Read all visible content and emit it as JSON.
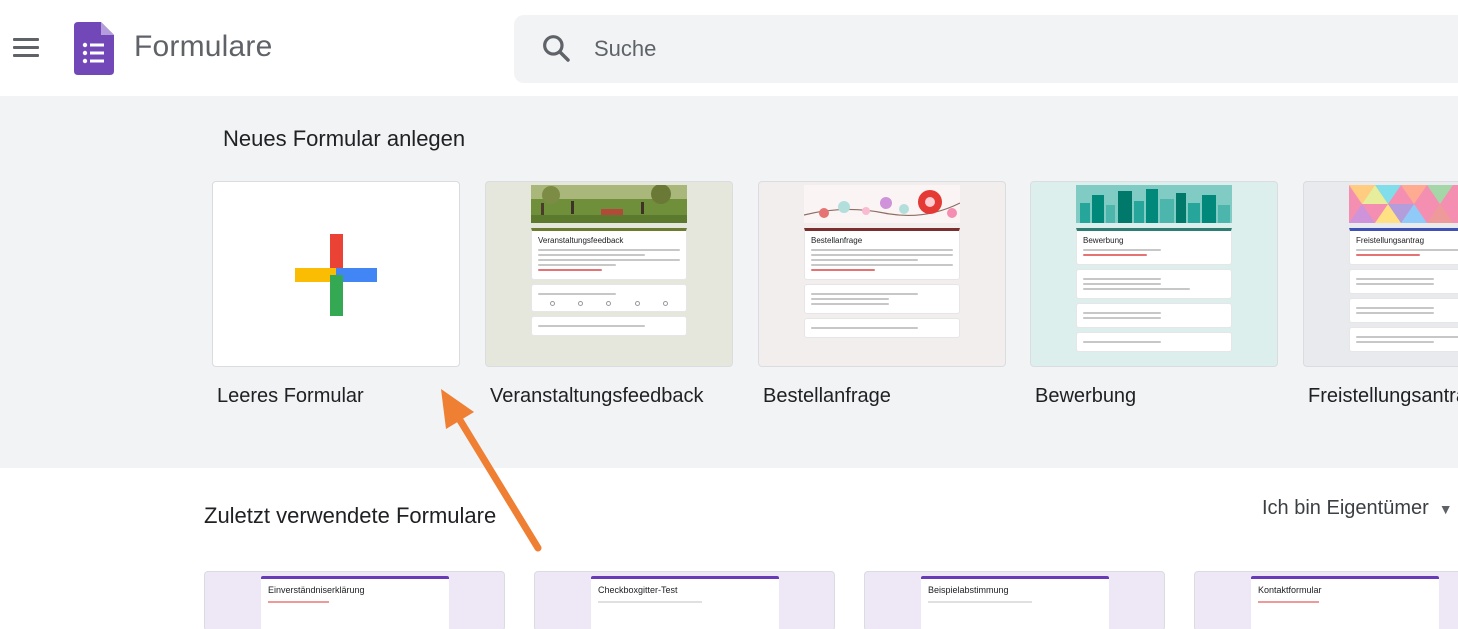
{
  "app": {
    "title": "Formulare"
  },
  "search": {
    "placeholder": "Suche"
  },
  "templates": {
    "section_title": "Neues Formular anlegen",
    "items": [
      {
        "label": "Leeres Formular"
      },
      {
        "label": "Veranstaltungsfeedback",
        "preview_title": "Veranstaltungsfeedback"
      },
      {
        "label": "Bestellanfrage",
        "preview_title": "Bestellanfrage"
      },
      {
        "label": "Bewerbung",
        "preview_title": "Bewerbung"
      },
      {
        "label": "Freistellungsantrag",
        "preview_title": "Freistellungsantrag"
      }
    ]
  },
  "recent": {
    "section_title": "Zuletzt verwendete Formulare",
    "owner_filter": "Ich bin Eigentümer",
    "items": [
      {
        "title": "Einverständniserklärung"
      },
      {
        "title": "Checkboxgitter-Test"
      },
      {
        "title": "Beispielabstimmung"
      },
      {
        "title": "Kontaktformular"
      }
    ]
  },
  "colors": {
    "forms_purple": "#673ab7",
    "annotation_arrow": "#ef7f33",
    "google_red": "#ea4335",
    "google_blue": "#4285f4",
    "google_yellow": "#fbbc04",
    "google_green": "#34a853"
  },
  "icons": {
    "menu": "hamburger-menu-icon",
    "logo": "google-forms-logo-icon",
    "search": "search-icon",
    "blank_form": "plus-icon",
    "owner_filter": "chevron-down-icon"
  }
}
